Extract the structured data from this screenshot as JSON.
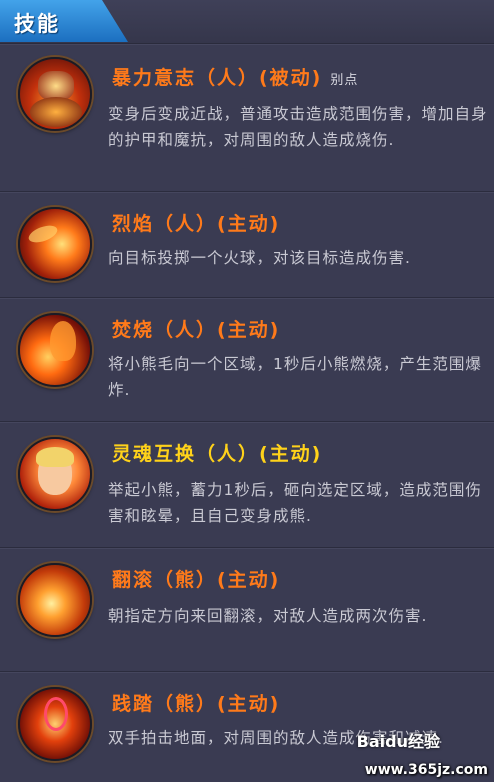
{
  "header": {
    "tab_label": "技能"
  },
  "skills": [
    {
      "name": "暴力意志（人）(被动)",
      "tag": "别点",
      "name_color": "#ff7a1a",
      "description": "变身后变成近战，普通攻击造成范围伤害，增加自身的护甲和魔抗，对周围的敌人造成烧伤.",
      "icon": "demon-bear-icon"
    },
    {
      "name": "烈焰（人）(主动)",
      "tag": "",
      "name_color": "#ff7a1a",
      "description": "向目标投掷一个火球，对该目标造成伤害.",
      "icon": "fireball-icon"
    },
    {
      "name": "焚烧（人）(主动)",
      "tag": "",
      "name_color": "#ff7a1a",
      "description": "将小熊毛向一个区域，1秒后小熊燃烧，产生范围爆炸.",
      "icon": "flame-swirl-icon"
    },
    {
      "name": "灵魂互换（人）(主动)",
      "tag": "",
      "name_color": "#ffd21a",
      "description": "举起小熊，蓄力1秒后，砸向选定区域，造成范围伤害和眩晕，且自己变身成熊.",
      "icon": "soul-swap-icon"
    },
    {
      "name": "翻滚（熊）(主动)",
      "tag": "",
      "name_color": "#ff7a1a",
      "description": "朝指定方向来回翻滚，对敌人造成两次伤害.",
      "icon": "fire-roll-icon"
    },
    {
      "name": "践踏（熊）(主动)",
      "tag": "",
      "name_color": "#ff7a1a",
      "description": "双手拍击地面，对周围的敌人造成伤害和减速.",
      "icon": "stomp-icon"
    }
  ],
  "watermark": {
    "brand": "Baidu经验",
    "url": "www.365jz.com"
  }
}
